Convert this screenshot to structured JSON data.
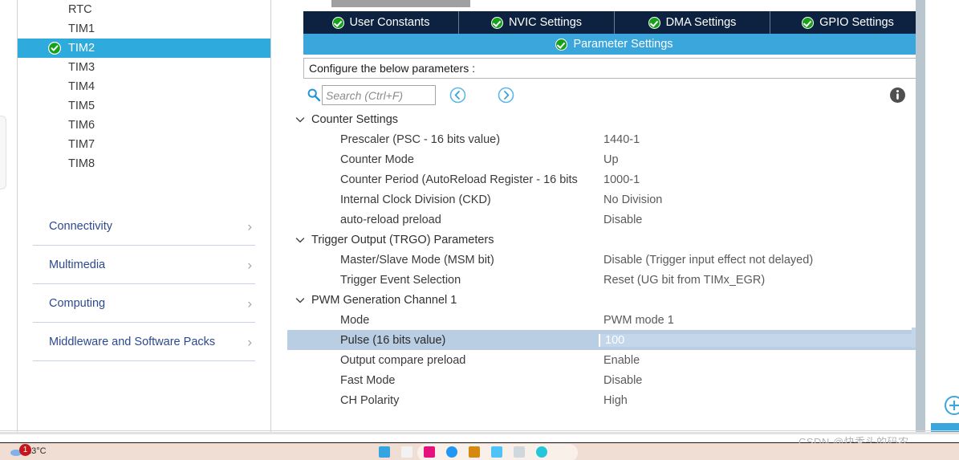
{
  "sidebar": {
    "peripherals": [
      {
        "label": "RTC",
        "selected": false,
        "checked": false
      },
      {
        "label": "TIM1",
        "selected": false,
        "checked": false
      },
      {
        "label": "TIM2",
        "selected": true,
        "checked": true
      },
      {
        "label": "TIM3",
        "selected": false,
        "checked": false
      },
      {
        "label": "TIM4",
        "selected": false,
        "checked": false
      },
      {
        "label": "TIM5",
        "selected": false,
        "checked": false
      },
      {
        "label": "TIM6",
        "selected": false,
        "checked": false
      },
      {
        "label": "TIM7",
        "selected": false,
        "checked": false
      },
      {
        "label": "TIM8",
        "selected": false,
        "checked": false
      }
    ],
    "categories": [
      {
        "label": "Connectivity",
        "chevron": "›"
      },
      {
        "label": "Multimedia",
        "chevron": "›"
      },
      {
        "label": "Computing",
        "chevron": "›"
      },
      {
        "label": "Middleware and Software Packs",
        "chevron": "›"
      }
    ]
  },
  "tabs": {
    "top": [
      {
        "label": "User Constants",
        "icon": "green-check-icon",
        "active": false
      },
      {
        "label": "NVIC Settings",
        "icon": "green-check-icon",
        "active": false
      },
      {
        "label": "DMA Settings",
        "icon": "green-check-icon",
        "active": false
      },
      {
        "label": "GPIO Settings",
        "icon": "green-check-icon",
        "active": false
      }
    ],
    "active": {
      "label": "Parameter Settings",
      "icon": "green-check-icon"
    }
  },
  "configure_bar": {
    "text": "Configure the below parameters :"
  },
  "search": {
    "placeholder": "Search (Ctrl+F)",
    "value": "",
    "icon": "search-icon",
    "back_icon": "circle-back-arrow-icon",
    "forward_icon": "circle-forward-arrow-icon",
    "info_icon": "info-icon"
  },
  "parameters": [
    {
      "group": "Counter Settings",
      "expanded": true,
      "rows": [
        {
          "name": "Prescaler (PSC - 16 bits value)",
          "value": "1440-1",
          "selected": false
        },
        {
          "name": "Counter Mode",
          "value": "Up",
          "selected": false
        },
        {
          "name": "Counter Period (AutoReload Register - 16 bits",
          "value": "1000-1",
          "selected": false
        },
        {
          "name": "Internal Clock Division (CKD)",
          "value": "No Division",
          "selected": false
        },
        {
          "name": "auto-reload preload",
          "value": "Disable",
          "selected": false
        }
      ]
    },
    {
      "group": "Trigger Output (TRGO) Parameters",
      "expanded": true,
      "rows": [
        {
          "name": "Master/Slave Mode (MSM bit)",
          "value": "Disable (Trigger input effect not delayed)",
          "selected": false
        },
        {
          "name": "Trigger Event Selection",
          "value": "Reset (UG bit from TIMx_EGR)",
          "selected": false
        }
      ]
    },
    {
      "group": "PWM Generation Channel 1",
      "expanded": true,
      "rows": [
        {
          "name": "Mode",
          "value": "PWM mode 1",
          "selected": false
        },
        {
          "name": "Pulse (16 bits value)",
          "value": "100",
          "selected": true
        },
        {
          "name": "Output compare preload",
          "value": "Enable",
          "selected": false
        },
        {
          "name": "Fast Mode",
          "value": "Disable",
          "selected": false
        },
        {
          "name": "CH Polarity",
          "value": "High",
          "selected": false
        }
      ]
    }
  ],
  "right_controls": {
    "zoom_in_icon": "circle-plus-zoom-icon"
  },
  "taskbar": {
    "weather": "23°C",
    "notification_count": "1"
  },
  "watermark": {
    "text": "CSDN @快秃头的码农"
  },
  "colors": {
    "tab_bar_dark": "#0d2240",
    "active_tab_blue": "#3aa6dc",
    "selection_blue": "#2eaadc",
    "row_selected": "#b9cde3",
    "category_text": "#2c4a8c",
    "check_green": "#17a01a"
  }
}
